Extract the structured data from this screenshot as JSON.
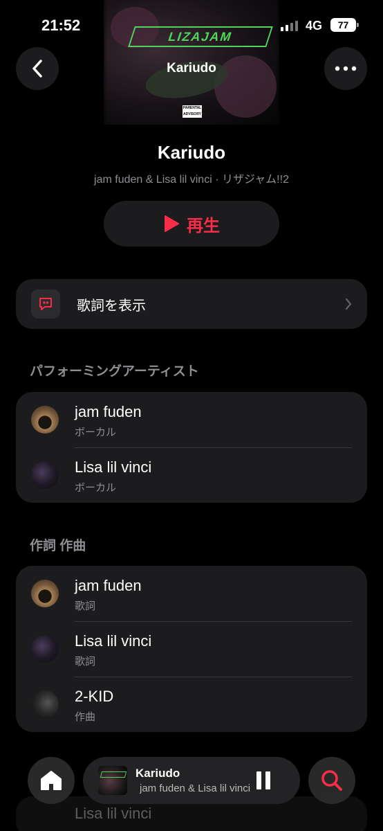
{
  "status": {
    "time": "21:52",
    "network": "4G",
    "battery": "77"
  },
  "nav": {
    "title": "Kariudo"
  },
  "song": {
    "title": "Kariudo",
    "subtitle": "jam fuden & Lisa lil vinci · リザジャム!!2",
    "play_label": "再生"
  },
  "lyrics": {
    "label": "歌詞を表示"
  },
  "sections": {
    "performers": {
      "title": "パフォーミングアーティスト",
      "items": [
        {
          "name": "jam fuden",
          "role": "ボーカル"
        },
        {
          "name": "Lisa lil vinci",
          "role": "ボーカル"
        }
      ]
    },
    "writers": {
      "title": "作詞 作曲",
      "items": [
        {
          "name": "jam fuden",
          "role": "歌詞"
        },
        {
          "name": "Lisa lil vinci",
          "role": "歌詞"
        },
        {
          "name": "2-KID",
          "role": "作曲"
        }
      ]
    }
  },
  "peek": {
    "name": "Lisa lil vinci"
  },
  "mini_player": {
    "title": "Kariudo",
    "subtitle": "jam fuden & Lisa lil vinci"
  },
  "colors": {
    "accent": "#fa2d48",
    "card": "#1c1c1e",
    "secondary_text": "#8e8e93"
  },
  "icons": {
    "back": "chevron-left-icon",
    "more": "ellipsis-icon",
    "play": "play-icon",
    "lyrics": "quote-bubble-icon",
    "home": "home-icon",
    "pause": "pause-icon",
    "search": "search-icon"
  }
}
